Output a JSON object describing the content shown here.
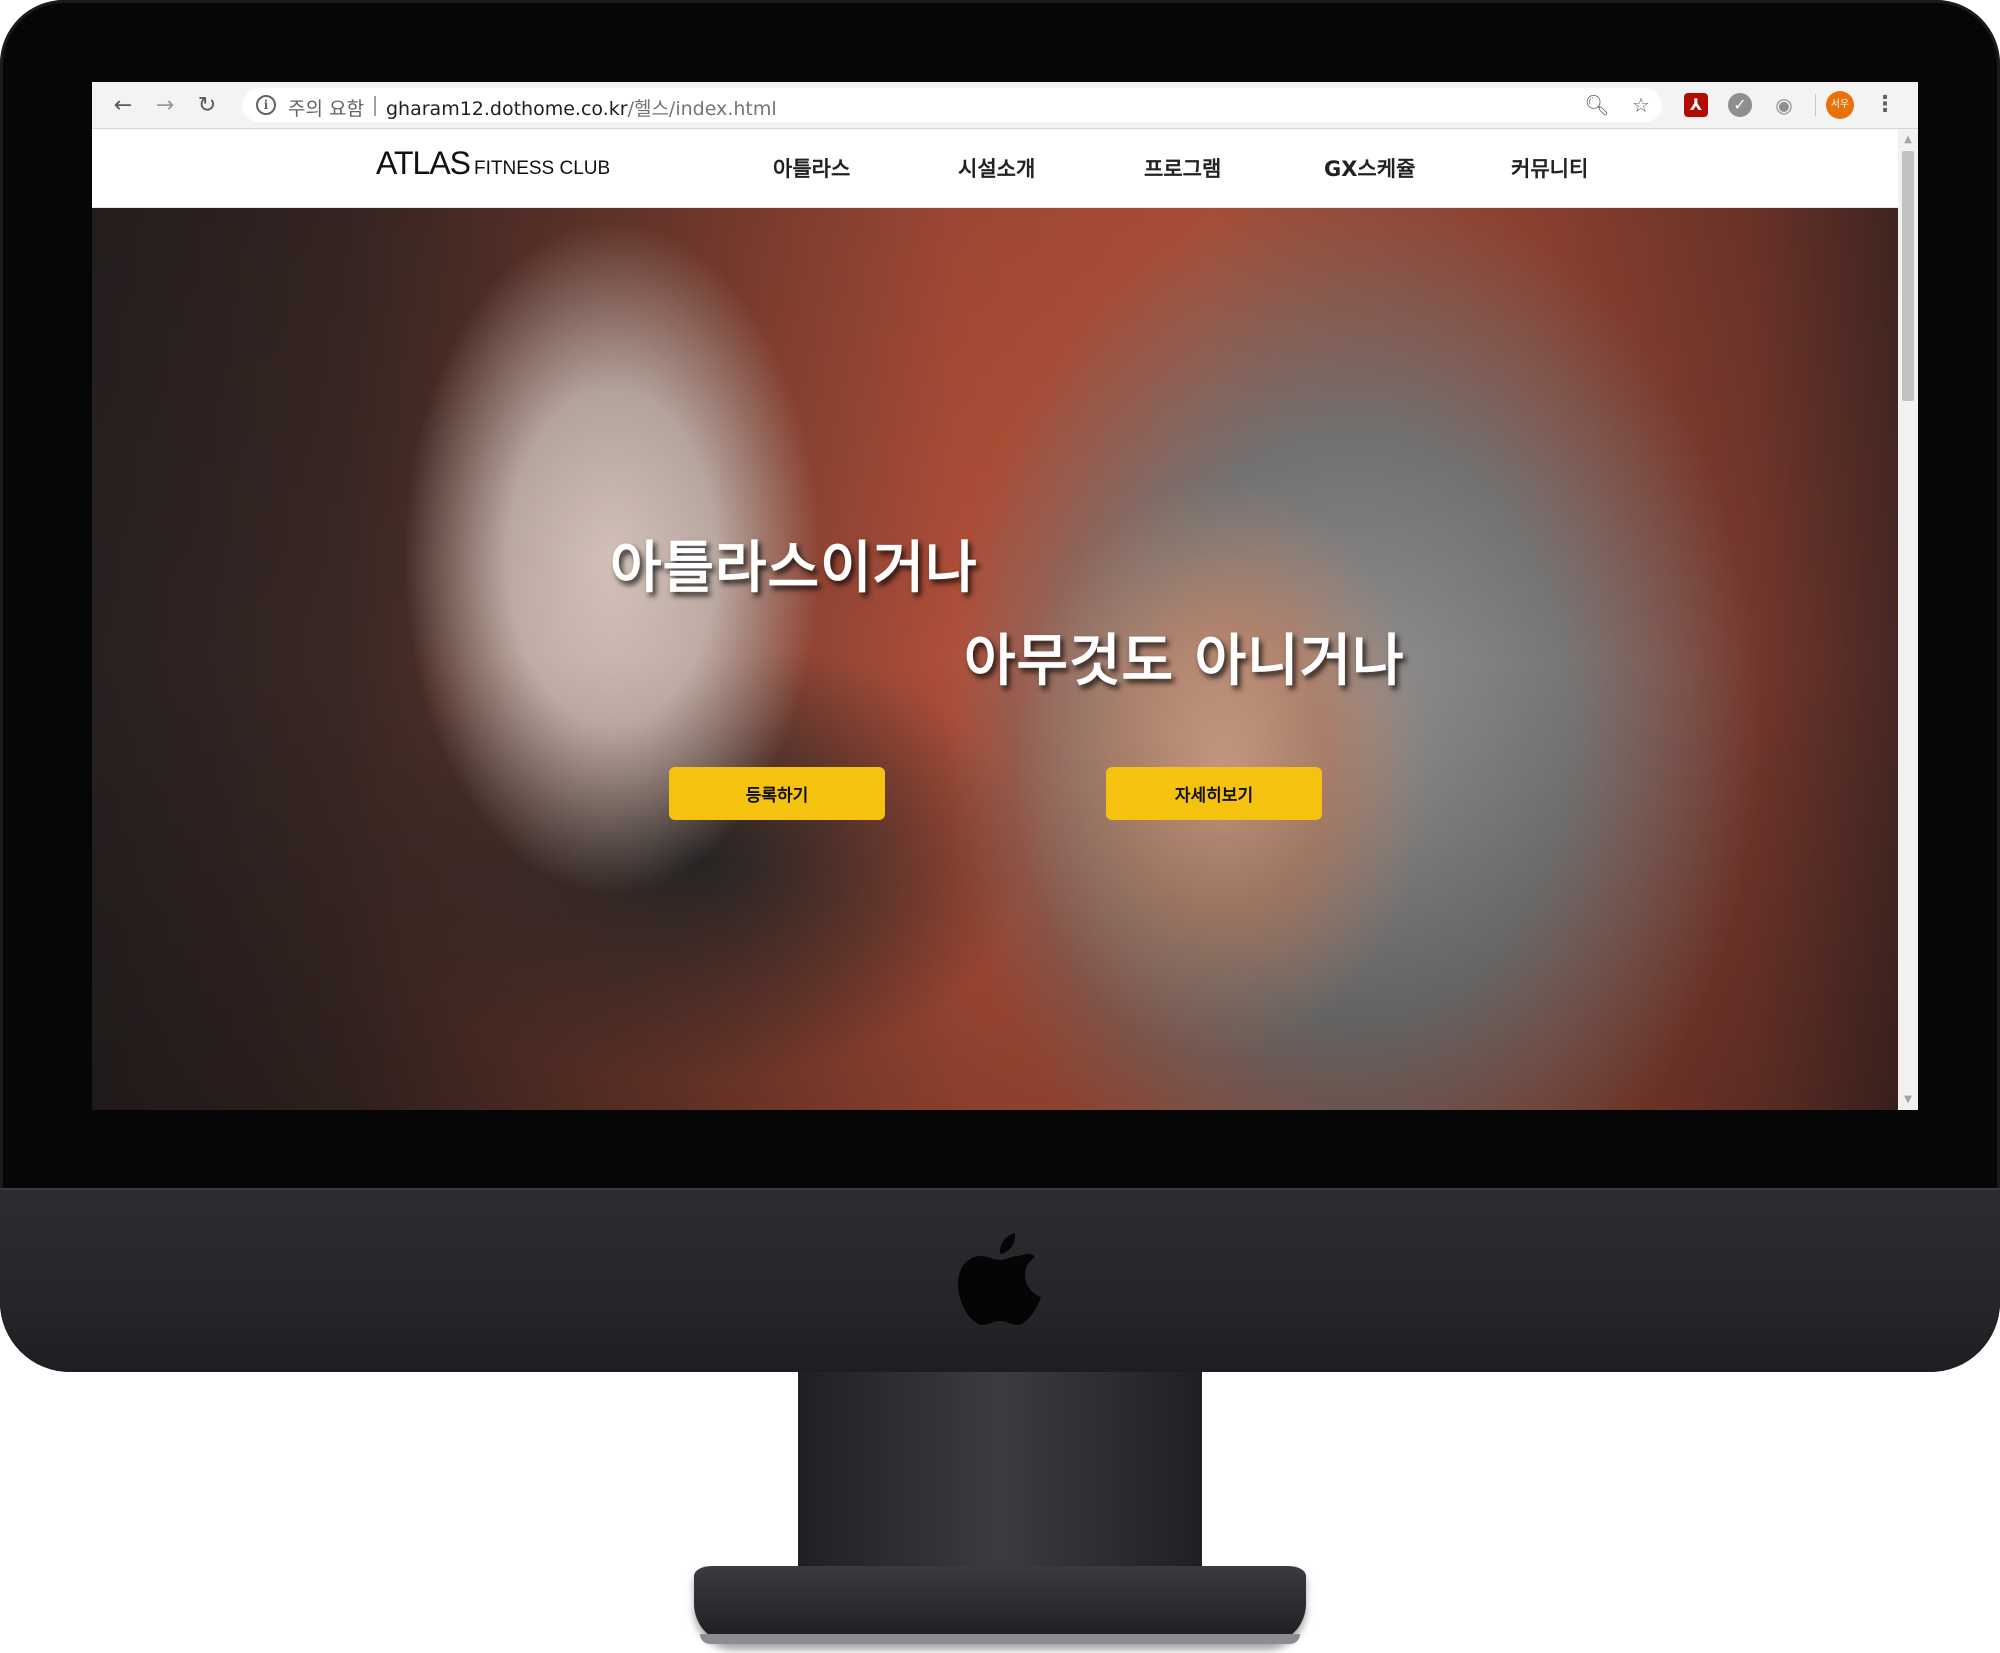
{
  "browser": {
    "security_warning": "주의 요함",
    "url_domain": "gharam12.dothome.co.kr",
    "url_path": "/헬스/index.html",
    "profile_label": "서우"
  },
  "site": {
    "logo_main": "ATLAS",
    "logo_sub": "FITNESS CLUB",
    "nav": [
      "아틀라스",
      "시설소개",
      "프로그램",
      "GX스케쥴",
      "커뮤니티"
    ]
  },
  "hero": {
    "line1": "아틀라스이거나",
    "line2": "아무것도 아니거나",
    "register_button": "등록하기",
    "details_button": "자세히보기",
    "button_color": "#f6c210"
  },
  "icons": {
    "back": "arrow-left",
    "forward": "arrow-right",
    "reload": "reload",
    "zoom": "magnifier",
    "bookmark": "star",
    "menu": "vertical-dots"
  }
}
